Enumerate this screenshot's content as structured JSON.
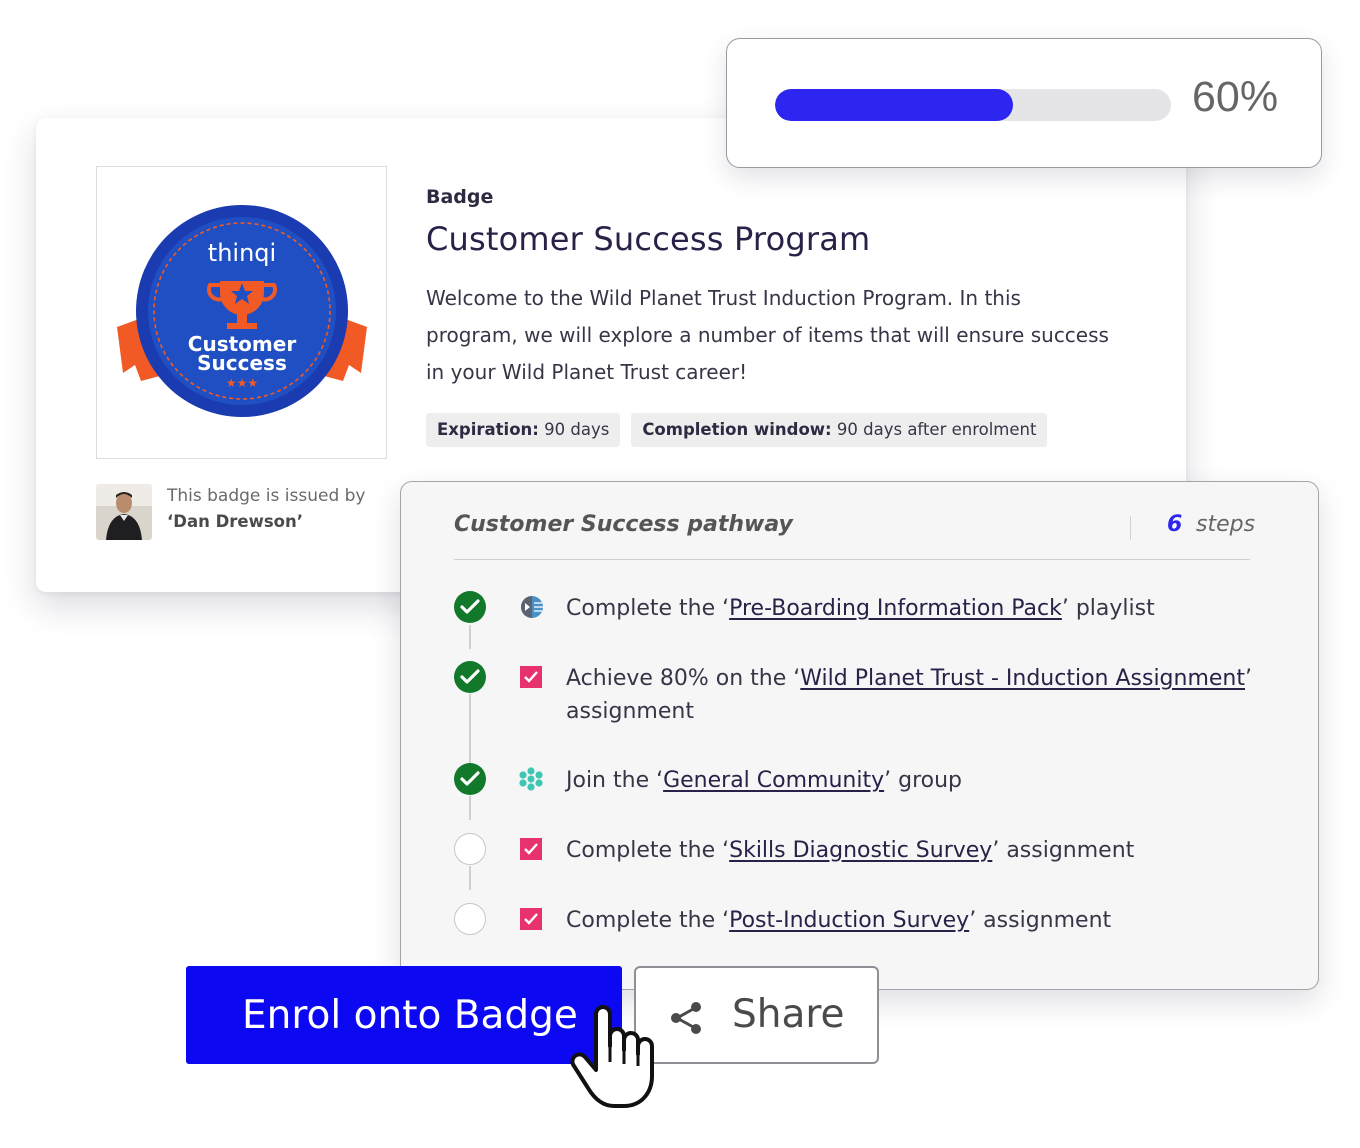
{
  "progress": {
    "value": 0.6,
    "label": "60%"
  },
  "badge": {
    "kicker": "Badge",
    "title": "Customer Success Program",
    "description": "Welcome to the Wild Planet Trust Induction Program. In this program, we will explore a number of items that will ensure success in your Wild Planet Trust career!",
    "image": {
      "brand": "thinqi",
      "line1": "Customer",
      "line2": "Success",
      "stars": "★★★"
    },
    "chips": [
      {
        "key": "Expiration:",
        "value": "90 days"
      },
      {
        "key": "Completion window:",
        "value": "90 days after enrolment"
      }
    ],
    "issuer": {
      "prefix": "This badge is issued by",
      "name": "‘Dan Drewson’"
    }
  },
  "pathway": {
    "title": "Customer Success pathway",
    "steps_count": "6",
    "steps_label": "steps",
    "steps": [
      {
        "done": true,
        "icon": "playlist-icon",
        "pre": "Complete the ‘",
        "link": "Pre-Boarding Information Pack",
        "post": "’ playlist"
      },
      {
        "done": true,
        "icon": "assignment-icon",
        "pre": "Achieve 80% on the ‘",
        "link": "Wild Planet Trust - Induction Assignment",
        "post": "’ assignment"
      },
      {
        "done": true,
        "icon": "community-icon",
        "pre": "Join the ‘",
        "link": "General Community",
        "post": "’ group"
      },
      {
        "done": false,
        "icon": "assignment-icon",
        "pre": "Complete the ‘",
        "link": "Skills Diagnostic Survey",
        "post": "’ assignment"
      },
      {
        "done": false,
        "icon": "assignment-icon",
        "pre": "Complete the ‘",
        "link": "Post-Induction Survey",
        "post": "’ assignment"
      }
    ]
  },
  "actions": {
    "enrol_label": "Enrol onto Badge",
    "share_label": "Share"
  },
  "colors": {
    "accent": "#0c08f2",
    "progress": "#2d26f0",
    "done": "#12792b",
    "badge_blue": "#1f3fa8",
    "ribbon": "#f15a24",
    "assignment": "#e8326e",
    "community": "#3cc6b3"
  }
}
